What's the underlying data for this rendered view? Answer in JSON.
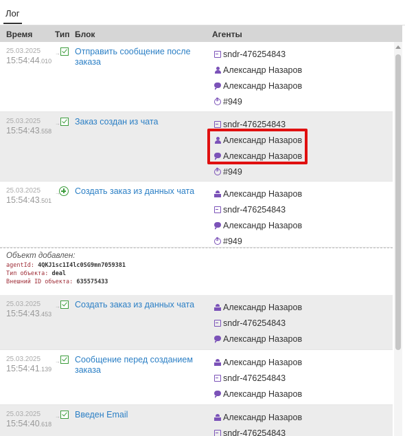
{
  "tab": "Лог",
  "columns": {
    "time": "Время",
    "type": "Тип",
    "block": "Блок",
    "agents": "Агенты"
  },
  "rows": [
    {
      "date": "25.03.2025",
      "time": "15:54:44",
      "ms": ".010",
      "icon": "checkbox",
      "block": "Отправить сообщение после заказа",
      "agents": [
        {
          "icon": "sender",
          "text": "sndr-476254843"
        },
        {
          "icon": "person",
          "text": "Александр Назаров"
        },
        {
          "icon": "chat",
          "text": "Александр Назаров"
        },
        {
          "icon": "deal",
          "text": "#949"
        }
      ]
    },
    {
      "date": "25.03.2025",
      "time": "15:54:43",
      "ms": ".558",
      "icon": "checkbox",
      "block": "Заказ создан из чата",
      "agents": [
        {
          "icon": "sender",
          "text": "sndr-476254843"
        },
        {
          "icon": "person",
          "text": "Александр Назаров"
        },
        {
          "icon": "chat",
          "text": "Александр Назаров"
        },
        {
          "icon": "deal",
          "text": "#949"
        }
      ]
    },
    {
      "date": "25.03.2025",
      "time": "15:54:43",
      "ms": ".501",
      "icon": "plus",
      "block": "Создать заказ из данных чата",
      "agents": [
        {
          "icon": "manager",
          "text": "Александр Назаров"
        },
        {
          "icon": "sender",
          "text": "sndr-476254843"
        },
        {
          "icon": "chat",
          "text": "Александр Назаров"
        },
        {
          "icon": "deal",
          "text": "#949"
        }
      ]
    },
    {
      "date": "25.03.2025",
      "time": "15:54:43",
      "ms": ".453",
      "icon": "checkbox",
      "block": "Создать заказ из данных чата",
      "agents": [
        {
          "icon": "manager",
          "text": "Александр Назаров"
        },
        {
          "icon": "sender",
          "text": "sndr-476254843"
        },
        {
          "icon": "chat",
          "text": "Александр Назаров"
        }
      ]
    },
    {
      "date": "25.03.2025",
      "time": "15:54:41",
      "ms": ".139",
      "icon": "checkbox",
      "block": "Сообщение перед созданием заказа",
      "agents": [
        {
          "icon": "manager",
          "text": "Александр Назаров"
        },
        {
          "icon": "sender",
          "text": "sndr-476254843"
        },
        {
          "icon": "chat",
          "text": "Александр Назаров"
        }
      ]
    },
    {
      "date": "25.03.2025",
      "time": "15:54:40",
      "ms": ".618",
      "icon": "checkbox",
      "block": "Введен Email",
      "agents": [
        {
          "icon": "manager",
          "text": "Александр Назаров"
        },
        {
          "icon": "sender",
          "text": "sndr-476254843"
        }
      ]
    }
  ],
  "details": {
    "title": "Объект добавлен:",
    "lines": [
      {
        "key": "agentId:",
        "value": "4QKJ1sc1I4lc0SG9mn7059381"
      },
      {
        "key": "Тип объекта:",
        "value": "deal"
      },
      {
        "key": "Внешний ID объекта:",
        "value": "635575433"
      }
    ]
  }
}
